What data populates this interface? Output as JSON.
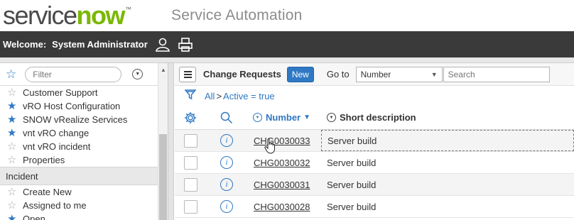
{
  "banner": {
    "logo_service": "service",
    "logo_now": "now",
    "logo_tm": "™",
    "title": "Service Automation"
  },
  "header": {
    "welcome": "Welcome:",
    "user": "System Administrator",
    "icons": [
      "user-icon",
      "printer-icon"
    ]
  },
  "nav": {
    "filter_placeholder": "Filter",
    "items": [
      {
        "label": "Customer Support",
        "star": "empty"
      },
      {
        "label": "vRO Host Configuration",
        "star": "filled"
      },
      {
        "label": "SNOW vRealize Services",
        "star": "filled"
      },
      {
        "label": "vnt vRO change",
        "star": "filled"
      },
      {
        "label": "vnt vRO incident",
        "star": "empty"
      },
      {
        "label": "Properties",
        "star": "empty"
      }
    ],
    "section": "Incident",
    "section_items": [
      {
        "label": "Create New",
        "star": "empty"
      },
      {
        "label": "Assigned to me",
        "star": "empty"
      },
      {
        "label": "Open",
        "star": "filled"
      }
    ]
  },
  "list": {
    "title": "Change Requests",
    "new_label": "New",
    "goto_label": "Go to",
    "goto_selected": "Number",
    "search_placeholder": "Search",
    "breadcrumb_all": "All",
    "breadcrumb_sep": ">",
    "breadcrumb_filter": "Active = true",
    "columns": {
      "number": "Number",
      "short_description": "Short description"
    },
    "rows": [
      {
        "number": "CHG0030033",
        "short_description": "Server build"
      },
      {
        "number": "CHG0030032",
        "short_description": "Server build"
      },
      {
        "number": "CHG0030031",
        "short_description": "Server build"
      },
      {
        "number": "CHG0030028",
        "short_description": "Server build"
      }
    ]
  },
  "colors": {
    "brand_green": "#7ab800",
    "accent_blue": "#2f78c4",
    "header_bg": "#3a3a3a"
  }
}
